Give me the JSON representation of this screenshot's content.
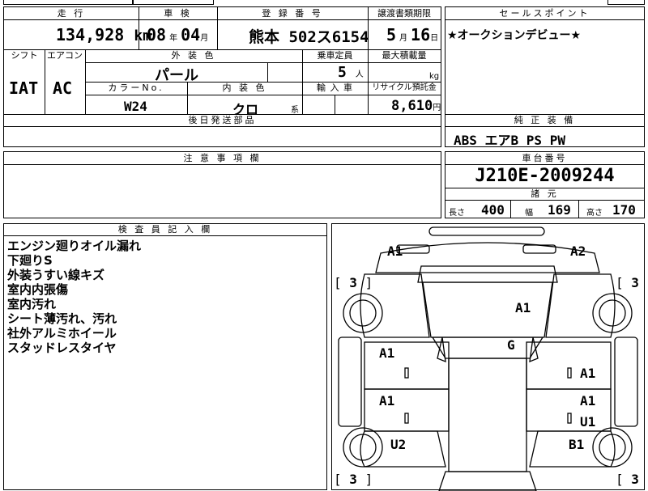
{
  "mileage": {
    "header": "走 行",
    "value": "134,928",
    "unit": "km"
  },
  "inspection": {
    "header": "車 検",
    "year": "08",
    "year_unit": "年",
    "month": "04",
    "month_unit": "月"
  },
  "registration": {
    "header": "登 録 番 号",
    "value": "熊本 502ス6154"
  },
  "transfer_deadline": {
    "header": "譲渡書類期限",
    "month": "5",
    "month_unit": "月",
    "day": "16",
    "day_unit": "日"
  },
  "sales_point": {
    "header": "セールスポイント",
    "text": "★オークションデビュー★"
  },
  "shift": {
    "header": "シフト",
    "value": "IAT"
  },
  "aircon": {
    "header": "エアコン",
    "value": "AC"
  },
  "exterior_color": {
    "header": "外 装 色",
    "value": "パール"
  },
  "capacity": {
    "header": "乗車定員",
    "value": "5",
    "unit": "人"
  },
  "max_load": {
    "header": "最大積載量",
    "unit": "kg"
  },
  "color_no": {
    "header": "カラーNo.",
    "value": "W24"
  },
  "interior_color": {
    "header": "内 装 色",
    "value": "クロ",
    "suffix": "系"
  },
  "import_car": {
    "header": "輸 入 車"
  },
  "recycle": {
    "header": "リサイクル預託金",
    "value": "8,610",
    "unit": "円"
  },
  "later_parts": {
    "header": "後日発送部品"
  },
  "standard_equipment": {
    "header": "純 正 装 備",
    "value": "ABS エアB PS PW"
  },
  "caution": {
    "header": "注 意 事 項 欄"
  },
  "chassis": {
    "header": "車台番号",
    "value": "J210E-2009244"
  },
  "specs": {
    "header": "諸 元",
    "length_label": "長さ",
    "length": "400",
    "width_label": "幅",
    "width": "169",
    "height_label": "高さ",
    "height": "170"
  },
  "inspector_notes": {
    "header": "検 査 員 記 入 欄",
    "lines": [
      "エンジン廻りオイル漏れ",
      "下廻りS",
      "外装うすい線キズ",
      "室内内張傷",
      "室内汚れ",
      "シート薄汚れ、汚れ",
      "社外アルミホイール",
      "スタッドレスタイヤ"
    ]
  },
  "diagram": {
    "marks": {
      "front_left": "A1",
      "front_right": "A2",
      "hood": "A1",
      "roof": "G",
      "left_front_door": "A1",
      "right_front_door": "A1",
      "left_rear_door": "A1",
      "right_rear_door_upper": "A1",
      "right_rear_door_lower": "U1",
      "left_rear_quarter": "U2",
      "right_rear_quarter": "B1"
    },
    "tires": {
      "front_left": "3",
      "front_right": "3",
      "rear_left": "3",
      "rear_right": "3"
    },
    "bracket_left": "[",
    "bracket_right": "]"
  }
}
